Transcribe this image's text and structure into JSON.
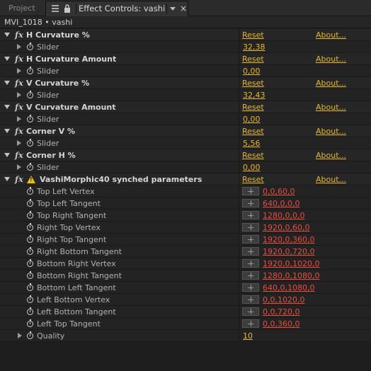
{
  "tabs": {
    "project_label": "Project",
    "active_label": "Effect Controls: vashi",
    "close_glyph": "×"
  },
  "comp": {
    "label": "MVI_1018 • vashi"
  },
  "common": {
    "fx_glyph": "fx",
    "reset_label": "Reset",
    "about_label": "About..."
  },
  "effects": [
    {
      "name": "H Curvature %",
      "param": "Slider",
      "value": "32,38"
    },
    {
      "name": "H Curvature Amount",
      "param": "Slider",
      "value": "0,00"
    },
    {
      "name": "V Curvature %",
      "param": "Slider",
      "value": "32,43"
    },
    {
      "name": "V Curvature Amount",
      "param": "Slider",
      "value": "0,00"
    },
    {
      "name": "Corner V %",
      "param": "Slider",
      "value": "5,56"
    },
    {
      "name": "Corner H %",
      "param": "Slider",
      "value": "0,00"
    }
  ],
  "morphic": {
    "name": "VashiMorphic40 synched parameters",
    "points": [
      {
        "name": "Top Left Vertex",
        "value": "0,0,60,0"
      },
      {
        "name": "Top Left Tangent",
        "value": "640,0,0,0"
      },
      {
        "name": "Top Right Tangent",
        "value": "1280,0,0,0"
      },
      {
        "name": "Right Top Vertex",
        "value": "1920,0,60,0"
      },
      {
        "name": "Right Top Tangent",
        "value": "1920,0,360,0"
      },
      {
        "name": "Right Bottom Tangent",
        "value": "1920,0,720,0"
      },
      {
        "name": "Bottom Right Vertex",
        "value": "1920,0,1020,0"
      },
      {
        "name": "Bottom Right Tangent",
        "value": "1280,0,1080,0"
      },
      {
        "name": "Bottom Left Tangent",
        "value": "640,0,1080,0"
      },
      {
        "name": "Left Bottom Vertex",
        "value": "0,0,1020,0"
      },
      {
        "name": "Left Bottom Tangent",
        "value": "0,0,720,0"
      },
      {
        "name": "Left Top Tangent",
        "value": "0,0,360,0"
      }
    ],
    "quality": {
      "name": "Quality",
      "value": "10"
    }
  },
  "colors": {
    "accent": "#e8b72c",
    "point_value": "#ea4d3e",
    "panel_bg": "#1e1e1e",
    "warning": "#f2c200"
  },
  "icons": [
    "panel-menu-icon",
    "lock-icon",
    "dropdown-arrow-icon",
    "close-icon",
    "twirl-down-icon",
    "twirl-right-icon",
    "fx-icon",
    "stopwatch-icon",
    "warning-icon",
    "crosshair-icon"
  ]
}
